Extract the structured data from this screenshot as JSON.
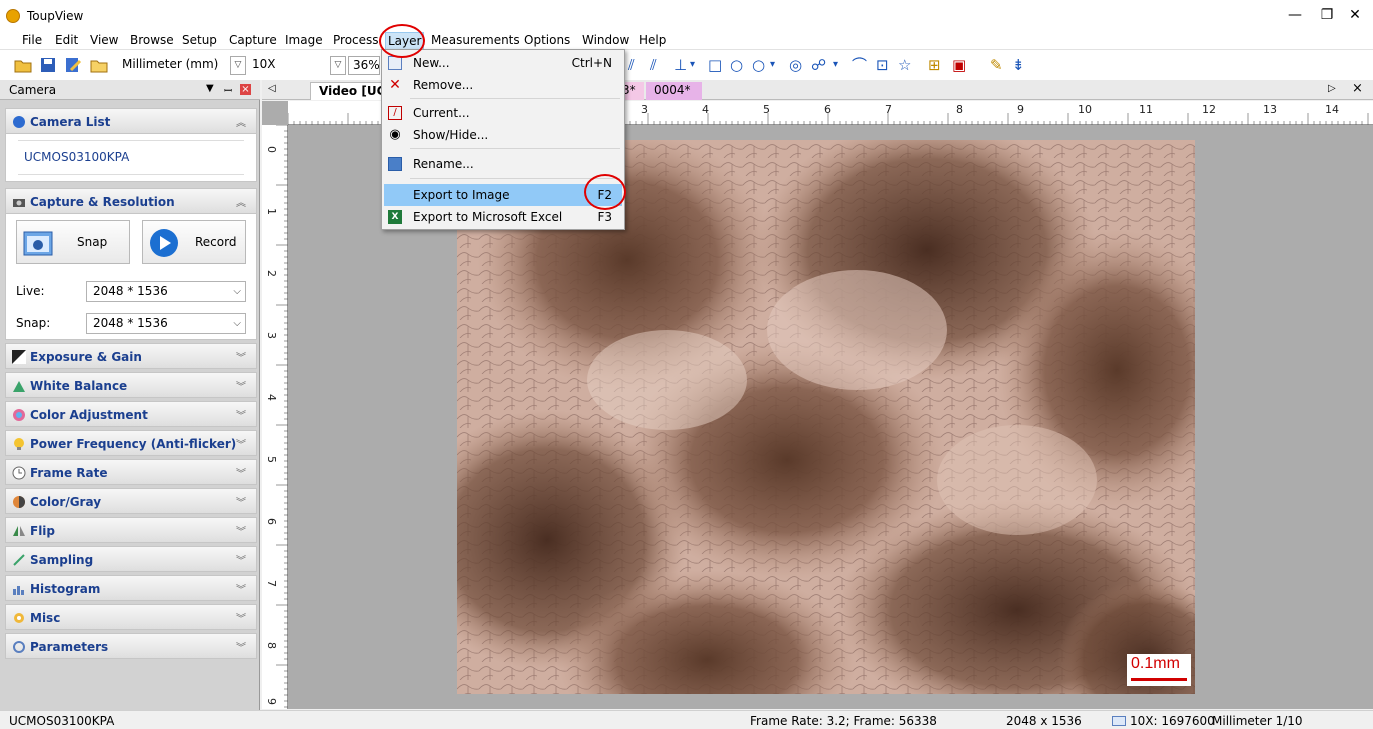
{
  "window": {
    "title": "ToupView",
    "minimize": "—",
    "restore": "❐",
    "close": "✕"
  },
  "menubar": [
    "File",
    "Edit",
    "View",
    "Browse",
    "Setup",
    "Capture",
    "Image",
    "Process",
    "Layer",
    "Measurements",
    "Options",
    "Window",
    "Help"
  ],
  "toolbar": {
    "unit_value": "Millimeter (mm)",
    "magnification_value": "10X",
    "zoom_value": "36%"
  },
  "layer_menu": {
    "items": [
      {
        "label": "New...",
        "shortcut": "Ctrl+N",
        "icon": "new-layer-icon"
      },
      {
        "label": "Remove...",
        "shortcut": "",
        "icon": "remove-x-icon"
      },
      {
        "label": "Current...",
        "shortcut": "",
        "icon": "current-layer-icon"
      },
      {
        "label": "Show/Hide...",
        "shortcut": "",
        "icon": "eye-icon"
      },
      {
        "label": "Rename...",
        "shortcut": "",
        "icon": "rename-icon"
      },
      {
        "label": "Export to Image",
        "shortcut": "F2",
        "icon": ""
      },
      {
        "label": "Export to Microsoft Excel",
        "shortcut": "F3",
        "icon": "excel-icon"
      }
    ],
    "highlighted": "Export to Image"
  },
  "left_panel": {
    "title": "Camera",
    "camera_list": {
      "header": "Camera List",
      "device": "UCMOS03100KPA"
    },
    "capture": {
      "header": "Capture & Resolution",
      "snap_label": "Snap",
      "record_label": "Record",
      "live_label": "Live:",
      "live_value": "2048 * 1536",
      "snap_res_label": "Snap:",
      "snap_res_value": "2048 * 1536"
    },
    "sections": [
      "Exposure & Gain",
      "White Balance",
      "Color Adjustment",
      "Power Frequency (Anti-flicker)",
      "Frame Rate",
      "Color/Gray",
      "Flip",
      "Sampling",
      "Histogram",
      "Misc",
      "Parameters"
    ]
  },
  "tabs": {
    "items": [
      "Video [UCM",
      "3*",
      "0004*"
    ]
  },
  "ruler": {
    "h_numbers": [
      "3",
      "4",
      "5",
      "6",
      "7",
      "8",
      "9",
      "10",
      "11",
      "12",
      "13",
      "14"
    ],
    "v_numbers": [
      "0",
      "1",
      "2",
      "3",
      "4",
      "5",
      "6",
      "7",
      "8",
      "9"
    ]
  },
  "image": {
    "scale_label": "0.1mm"
  },
  "statusbar": {
    "camera": "UCMOS03100KPA",
    "frame": "Frame Rate: 3.2; Frame: 56338",
    "resolution": "2048 x 1536",
    "magnification": "10X: 1697600",
    "unit": "Millimeter 1/10"
  },
  "colors": {
    "accent": "#1b3f8f",
    "highlight": "#91c9f7",
    "annotation": "#e00000"
  }
}
